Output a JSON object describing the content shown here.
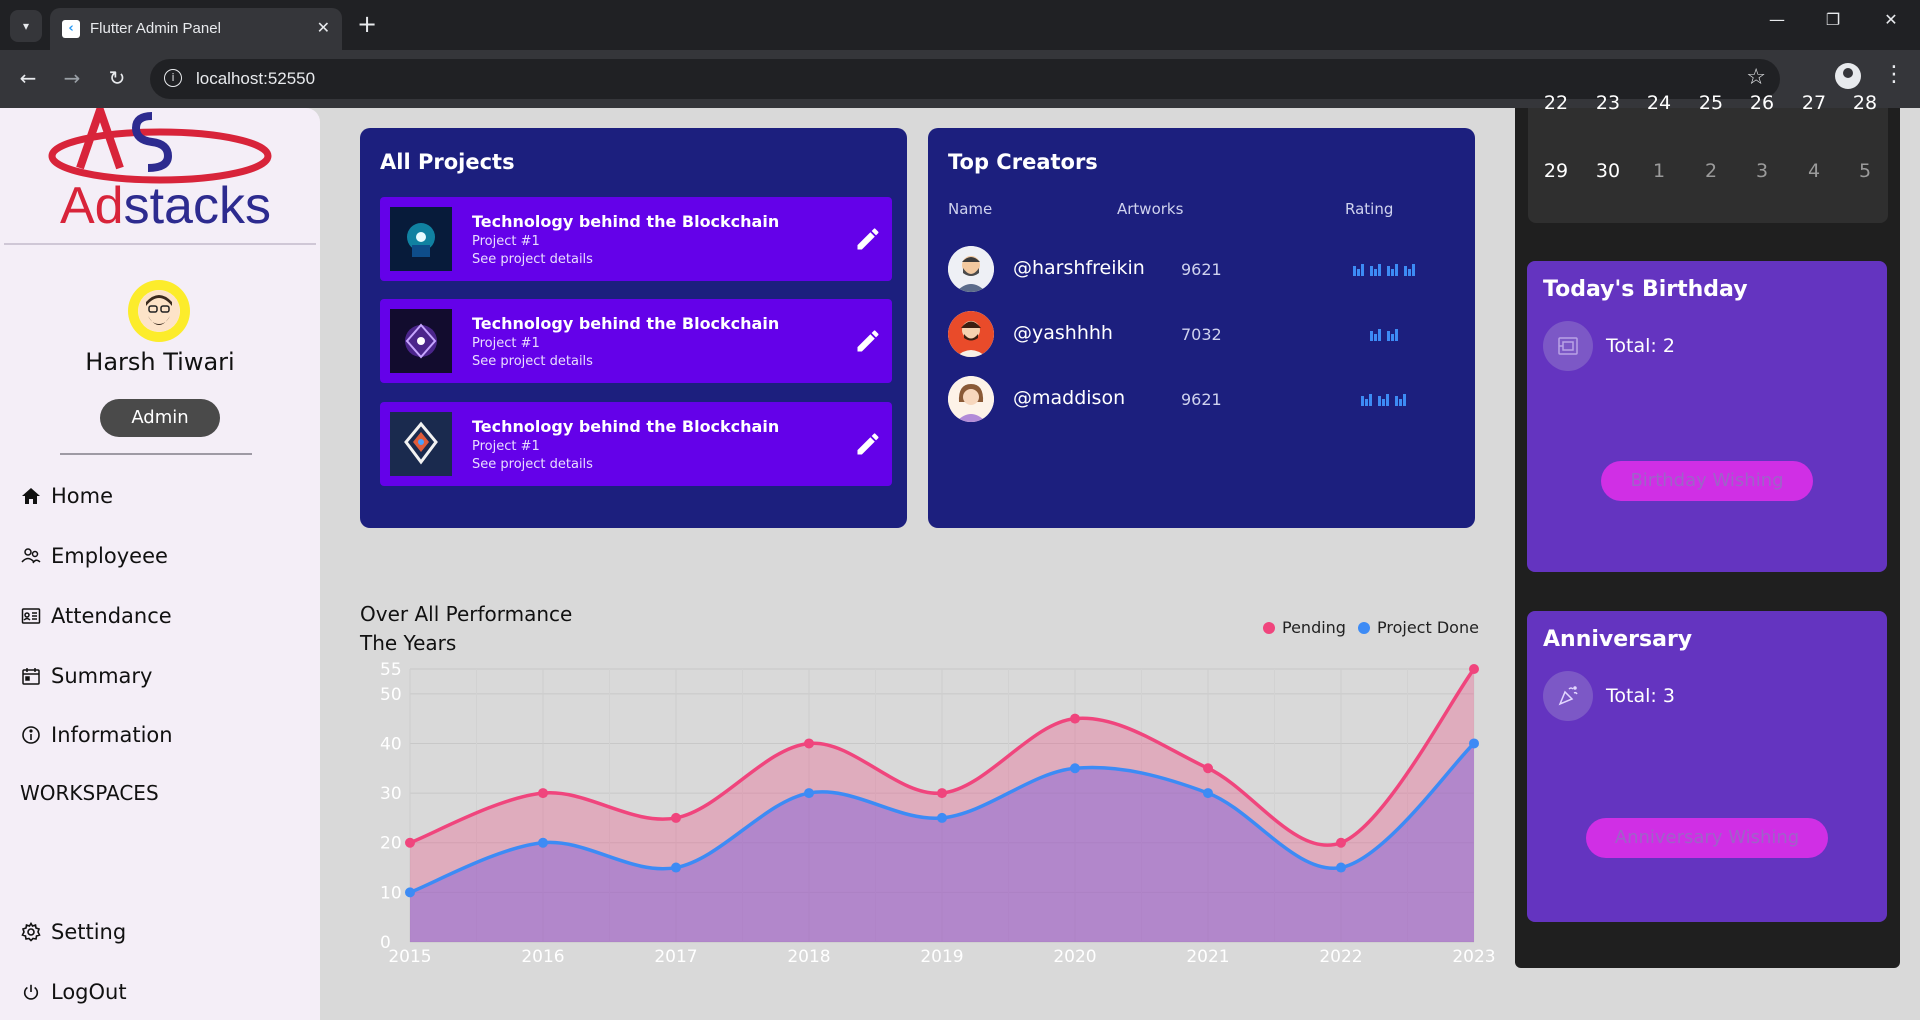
{
  "browser": {
    "tab_title": "Flutter Admin Panel",
    "url": "localhost:52550"
  },
  "sidebar": {
    "logo_text_a": "Ad",
    "logo_text_b": "stacks",
    "logo_mark": "AS",
    "user_name": "Harsh Tiwari",
    "role": "Admin",
    "items": [
      {
        "label": "Home",
        "icon": "home-icon"
      },
      {
        "label": "Employeee",
        "icon": "employees-icon"
      },
      {
        "label": "Attendance",
        "icon": "attendance-icon"
      },
      {
        "label": "Summary",
        "icon": "summary-icon"
      },
      {
        "label": "Information",
        "icon": "info-icon"
      }
    ],
    "workspaces_label": "WORKSPACES",
    "setting_label": "Setting",
    "logout_label": "LogOut"
  },
  "projects": {
    "title": "All Projects",
    "items": [
      {
        "name": "Technology behind the Blockchain",
        "sub": "Project #1",
        "link": "See project details"
      },
      {
        "name": "Technology behind the Blockchain",
        "sub": "Project #1",
        "link": "See project details"
      },
      {
        "name": "Technology behind the Blockchain",
        "sub": "Project #1",
        "link": "See project details"
      }
    ]
  },
  "creators": {
    "title": "Top Creators",
    "headers": {
      "name": "Name",
      "artworks": "Artworks",
      "rating": "Rating"
    },
    "rows": [
      {
        "handle": "@harshfreikin",
        "artworks": "9621",
        "rating_bars": 4
      },
      {
        "handle": "@yashhhh",
        "artworks": "7032",
        "rating_bars": 2
      },
      {
        "handle": "@maddison",
        "artworks": "9621",
        "rating_bars": 3
      }
    ]
  },
  "chart_data": {
    "type": "area",
    "title": "Over All Performance\nThe Years",
    "x": [
      "2015",
      "2016",
      "2017",
      "2018",
      "2019",
      "2020",
      "2021",
      "2022",
      "2023"
    ],
    "yticks": [
      "0",
      "10",
      "20",
      "30",
      "40",
      "50",
      "55"
    ],
    "ylim": [
      0,
      55
    ],
    "series": [
      {
        "name": "Pending",
        "color": "#f0457d",
        "values": [
          20,
          30,
          25,
          40,
          30,
          45,
          35,
          20,
          55
        ]
      },
      {
        "name": "Project Done",
        "color": "#3d8bf5",
        "values": [
          10,
          20,
          15,
          30,
          25,
          35,
          30,
          15,
          40
        ]
      }
    ],
    "legend_position": "top-right",
    "grid": true
  },
  "calendar": {
    "partial_row": [
      "22",
      "23",
      "24",
      "25",
      "26",
      "27",
      "28"
    ],
    "last_row": [
      "29",
      "30",
      "1",
      "2",
      "3",
      "4",
      "5"
    ]
  },
  "birthday": {
    "title": "Today's Birthday",
    "total": "Total: 2",
    "button": "Birthday Wishing"
  },
  "anniversary": {
    "title": "Anniversary",
    "total": "Total: 3",
    "button": "Anniversary Wishing"
  }
}
